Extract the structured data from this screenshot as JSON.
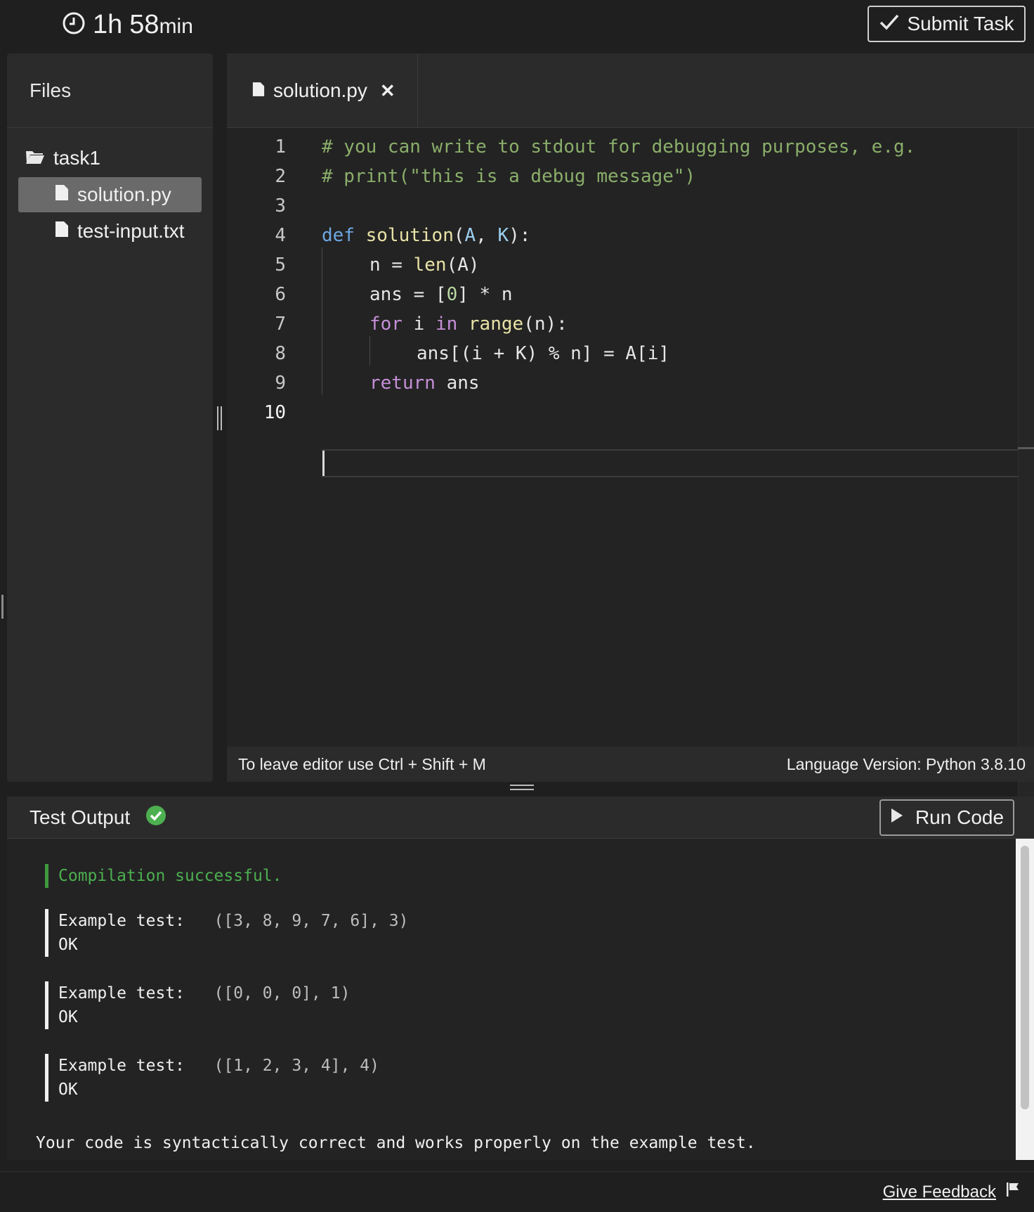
{
  "timer": {
    "hours": "1h",
    "minutes": "58",
    "unit": "min"
  },
  "header": {
    "submit_label": "Submit Task"
  },
  "files": {
    "title": "Files",
    "folder": "task1",
    "items": [
      {
        "label": "solution.py",
        "selected": true
      },
      {
        "label": "test-input.txt",
        "selected": false
      }
    ]
  },
  "editor": {
    "tab_label": "solution.py",
    "line_numbers": [
      "1",
      "2",
      "3",
      "4",
      "5",
      "6",
      "7",
      "8",
      "9",
      "10"
    ],
    "lines": {
      "l1": "# you can write to stdout for debugging purposes, e.g.",
      "l2": "# print(\"this is a debug message\")",
      "l4_def": "def",
      "l4_fn": "solution",
      "l4_p1": "A",
      "l4_p2": "K",
      "l5_a": "n = ",
      "l5_fn": "len",
      "l5_b": "(A)",
      "l6_a": "ans = [",
      "l6_num": "0",
      "l6_b": "] * n",
      "l7_for": "for",
      "l7_mid": " i ",
      "l7_in": "in",
      "l7_fn": "range",
      "l7_b": "(n):",
      "l8": "ans[(i + K) % n] = A[i]",
      "l9_ret": "return",
      "l9_b": " ans"
    },
    "status_left": "To leave editor use Ctrl + Shift + M",
    "status_right": "Language Version: Python 3.8.10"
  },
  "output": {
    "title": "Test Output",
    "status": "success",
    "run_label": "Run Code",
    "compilation": "Compilation successful.",
    "tests": [
      {
        "label": "Example test:",
        "args": "([3, 8, 9, 7, 6], 3)",
        "result": "OK"
      },
      {
        "label": "Example test:",
        "args": "([0, 0, 0], 1)",
        "result": "OK"
      },
      {
        "label": "Example test:",
        "args": "([1, 2, 3, 4], 4)",
        "result": "OK"
      }
    ],
    "summary": "Your code is syntactically correct and works properly on the example test."
  },
  "footer": {
    "feedback_label": "Give Feedback"
  },
  "colors": {
    "background": "#1f1f1f",
    "panel": "#2b2b2b",
    "success_green": "#4caf50",
    "comment": "#8aae6a",
    "keyword": "#6ca7e0",
    "control": "#c58fd8"
  },
  "icons": [
    "clock-icon",
    "check-icon",
    "folder-icon",
    "file-icon",
    "close-icon",
    "success-check-icon",
    "play-icon",
    "flag-icon"
  ]
}
